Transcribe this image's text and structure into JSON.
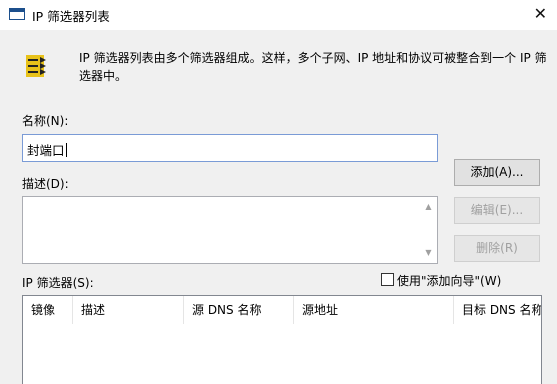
{
  "window": {
    "title": "IP 筛选器列表",
    "close_glyph": "✕"
  },
  "description": "IP 筛选器列表由多个筛选器组成。这样，多个子网、IP 地址和协议可被整合到一个 IP 筛选器中。",
  "name_field": {
    "label": "名称(N):",
    "value": "封端口"
  },
  "desc_field": {
    "label": "描述(D):",
    "value": ""
  },
  "buttons": {
    "add": "添加(A)...",
    "edit": "编辑(E)...",
    "delete": "删除(R)"
  },
  "filters_label": "IP 筛选器(S):",
  "wizard_checkbox": {
    "label": "使用\"添加向导\"(W)",
    "checked": false
  },
  "table": {
    "columns": [
      "镜像",
      "描述",
      "源 DNS 名称",
      "源地址",
      "目标 DNS 名称"
    ],
    "rows": []
  },
  "colors": {
    "accent": "#1c4f8c",
    "icon_yellow": "#e8c21a",
    "input_border": "#7a9bd6"
  },
  "icons": {
    "window": "window-icon",
    "filter": "filter-list-icon",
    "close": "close-icon"
  }
}
